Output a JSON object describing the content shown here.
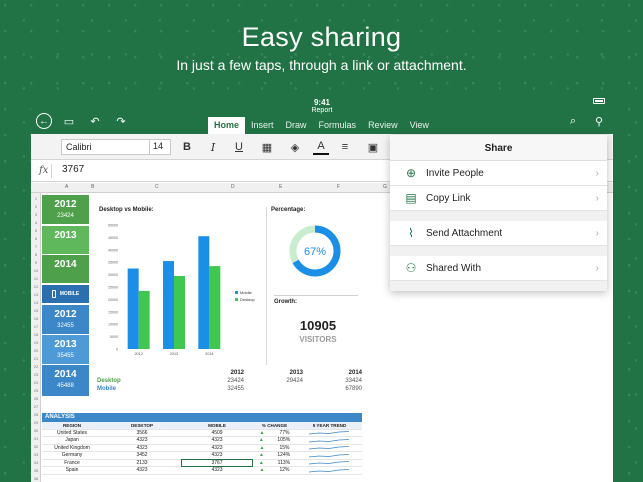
{
  "promo": {
    "heading": "Easy sharing",
    "subheading": "In just a few taps, through a link or attachment."
  },
  "status": {
    "time": "9:41",
    "file_name": "Report"
  },
  "tabs": [
    {
      "label": "Home",
      "active": true
    },
    {
      "label": "Insert"
    },
    {
      "label": "Draw"
    },
    {
      "label": "Formulas"
    },
    {
      "label": "Review"
    },
    {
      "label": "View"
    }
  ],
  "icons": {
    "back": "back-arrow-icon",
    "file": "file-save-icon",
    "undo": "undo-icon",
    "redo": "redo-icon",
    "search": "search-icon",
    "share": "add-person-icon"
  },
  "ribbon": {
    "font": "Calibri",
    "size": "14",
    "bold": "B",
    "italic": "I",
    "underline": "U"
  },
  "formula": {
    "fx": "fx",
    "value": "3767"
  },
  "columns": [
    "A",
    "B",
    "C",
    "D",
    "E",
    "F",
    "G"
  ],
  "sidebar_blocks": [
    {
      "year": "2012",
      "value": "23424",
      "style": "g1"
    },
    {
      "year": "2013",
      "value": "",
      "style": "g2"
    },
    {
      "year": "2014",
      "value": "",
      "style": "g1"
    },
    {
      "year": "2012",
      "value": "32455",
      "style": "b1"
    },
    {
      "year": "2013",
      "value": "35455",
      "style": "b2"
    },
    {
      "year": "2014",
      "value": "45488",
      "style": "b1"
    }
  ],
  "mobile_label": "MOBILE",
  "chart_title": "Desktop vs Mobile:",
  "chart_data": {
    "type": "bar",
    "categories": [
      "2012",
      "2013",
      "2014"
    ],
    "series": [
      {
        "name": "Mobile",
        "values": [
          32455,
          35455,
          45488
        ],
        "color": "#1b8fe8"
      },
      {
        "name": "Desktop",
        "values": [
          23424,
          29424,
          33424
        ],
        "color": "#3fc750"
      }
    ],
    "ylim": [
      0,
      50000
    ],
    "yticks": [
      "0",
      "5000",
      "10000",
      "15000",
      "20000",
      "25000",
      "30000",
      "35000",
      "40000",
      "45000",
      "50000"
    ],
    "legend": "right"
  },
  "percentage": {
    "label": "Percentage:",
    "value": "67%",
    "fraction": 0.67
  },
  "growth": {
    "label": "Growth:",
    "number": "10905",
    "unit": "VISITORS"
  },
  "mini_table": {
    "years": [
      "2012",
      "2013",
      "2014"
    ],
    "rows": [
      {
        "label": "Desktop",
        "values": [
          "23424",
          "29424",
          "33424"
        ],
        "color": "#4ea04b"
      },
      {
        "label": "Mobile",
        "values": [
          "32455",
          "",
          "67890"
        ],
        "color": "#3b87c7"
      }
    ]
  },
  "analysis": {
    "title": "ANALYSIS",
    "headers": [
      "REGION",
      "DESKTOP",
      "MOBILE",
      "% CHANGE",
      "5 YEAR TREND"
    ],
    "rows": [
      {
        "region": "United States",
        "desktop": "3566",
        "mobile": "4509",
        "change": "77%"
      },
      {
        "region": "Japan",
        "desktop": "4323",
        "mobile": "4323",
        "change": "105%"
      },
      {
        "region": "United Kingdom",
        "desktop": "4323",
        "mobile": "4323",
        "change": "15%"
      },
      {
        "region": "Germany",
        "desktop": "3452",
        "mobile": "4323",
        "change": "124%"
      },
      {
        "region": "France",
        "desktop": "2133",
        "mobile": "3767",
        "change": "113%",
        "selected": true
      },
      {
        "region": "Spain",
        "desktop": "4323",
        "mobile": "4323",
        "change": "12%"
      }
    ]
  },
  "share_panel": {
    "title": "Share",
    "items": [
      {
        "label": "Invite People",
        "icon": "invite-person-icon",
        "glyph": "⊕"
      },
      {
        "label": "Copy Link",
        "icon": "clipboard-icon",
        "glyph": "▤"
      },
      {
        "label": "Send Attachment",
        "icon": "paperclip-icon",
        "glyph": "⌇"
      },
      {
        "label": "Shared With",
        "icon": "people-icon",
        "glyph": "⚇"
      }
    ]
  }
}
